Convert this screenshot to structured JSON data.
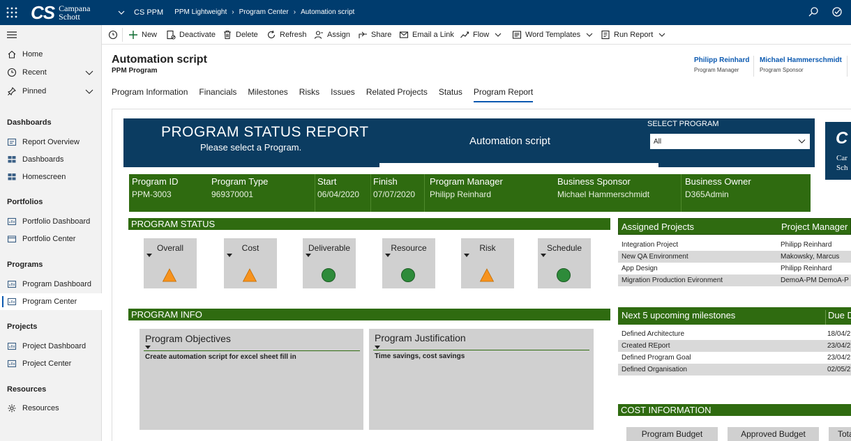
{
  "app": {
    "logo_text": "CS",
    "logo_name_line1": "Campana",
    "logo_name_line2": "Schott",
    "breadcrumbs": [
      "CS PPM",
      "PPM Lightweight",
      "Program Center",
      "Automation script"
    ]
  },
  "sidebar": {
    "top_items": [
      {
        "label": "Home"
      },
      {
        "label": "Recent"
      },
      {
        "label": "Pinned"
      }
    ],
    "groups": [
      {
        "heading": "Dashboards",
        "items": [
          "Report Overview",
          "Dashboards",
          "Homescreen"
        ]
      },
      {
        "heading": "Portfolios",
        "items": [
          "Portfolio Dashboard",
          "Portfolio Center"
        ]
      },
      {
        "heading": "Programs",
        "items": [
          "Program Dashboard",
          "Program Center"
        ]
      },
      {
        "heading": "Projects",
        "items": [
          "Project Dashboard",
          "Project Center"
        ]
      },
      {
        "heading": "Resources",
        "items": [
          "Resources"
        ]
      }
    ]
  },
  "commands": [
    "New",
    "Deactivate",
    "Delete",
    "Refresh",
    "Assign",
    "Share",
    "Email a Link",
    "Flow",
    "Word Templates",
    "Run Report"
  ],
  "record": {
    "title": "Automation script",
    "entity": "PPM Program",
    "people": [
      {
        "name": "Philipp Reinhard",
        "role": "Program Manager"
      },
      {
        "name": "Michael Hammerschmidt",
        "role": "Program Sponsor"
      }
    ]
  },
  "tabs": [
    "Program Information",
    "Financials",
    "Milestones",
    "Risks",
    "Issues",
    "Related Projects",
    "Status",
    "Program Report"
  ],
  "report": {
    "title": "PROGRAM STATUS REPORT",
    "subtitle": "Please select a Program.",
    "program_name": "Automation script",
    "select_label": "SELECT PROGRAM",
    "select_value": "All",
    "side_logo_cs": "C",
    "side_logo_text1": "Car",
    "side_logo_text2": "Sch",
    "info": {
      "headers": [
        "Program ID",
        "Program Type",
        "Start",
        "Finish",
        "Program Manager",
        "Business Sponsor",
        "Business Owner"
      ],
      "values": [
        "PPM-3003",
        "969370001",
        "06/04/2020",
        "07/07/2020",
        "Philipp Reinhard",
        "Michael Hammerschmidt",
        "D365Admin"
      ]
    },
    "status_heading": "PROGRAM STATUS",
    "status": [
      {
        "label": "Overall",
        "indicator": "warning-triangle"
      },
      {
        "label": "Cost",
        "indicator": "warning-triangle"
      },
      {
        "label": "Deliverable",
        "indicator": "ok-circle"
      },
      {
        "label": "Resource",
        "indicator": "ok-circle"
      },
      {
        "label": "Risk",
        "indicator": "warning-triangle"
      },
      {
        "label": "Schedule",
        "indicator": "ok-circle"
      }
    ],
    "colors": {
      "green": "#2f6b10",
      "warning": "#f7931e",
      "ok": "#2e8b3a",
      "navy": "#0b3c61"
    },
    "program_info_heading": "PROGRAM INFO",
    "objectives_label": "Program Objectives",
    "objectives_text": "Create automation script for excel sheet fill in",
    "justification_label": "Program Justification",
    "justification_text": "Time savings, cost savings",
    "assigned": {
      "headers": [
        "Assigned Projects",
        "Project Manager"
      ],
      "rows": [
        [
          "Integration Project",
          "Philipp Reinhard"
        ],
        [
          "New QA Environment",
          "Makowsky, Marcus"
        ],
        [
          "App Design",
          "Philipp Reinhard"
        ],
        [
          "Migration Production Evironment",
          "DemoA-PM DemoA-P"
        ]
      ]
    },
    "milestones": {
      "headers": [
        "Next 5 upcoming milestones",
        "Due D"
      ],
      "rows": [
        [
          "Defined Architecture",
          "18/04/2"
        ],
        [
          "Created REport",
          "23/04/2"
        ],
        [
          "Defined Program Goal",
          "23/04/2"
        ],
        [
          "Defined Organisation",
          "02/05/2"
        ]
      ]
    },
    "cost_heading": "COST INFORMATION",
    "budget_labels": [
      "Program Budget",
      "Approved Budget",
      "Tota"
    ]
  }
}
